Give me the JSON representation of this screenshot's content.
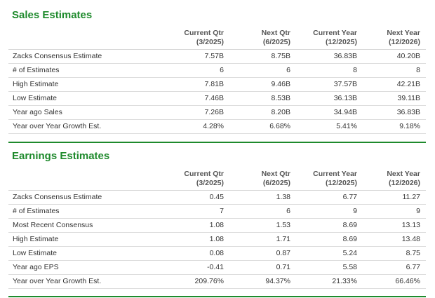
{
  "colors": {
    "accent": "#1e8a2c",
    "row_rule": "#dddddd"
  },
  "columns": [
    {
      "line1": "Current Qtr",
      "line2": "(3/2025)"
    },
    {
      "line1": "Next Qtr",
      "line2": "(6/2025)"
    },
    {
      "line1": "Current Year",
      "line2": "(12/2025)"
    },
    {
      "line1": "Next Year",
      "line2": "(12/2026)"
    }
  ],
  "sales": {
    "title": "Sales Estimates",
    "rows": [
      {
        "label": "Zacks Consensus Estimate",
        "values": [
          "7.57B",
          "8.75B",
          "36.83B",
          "40.20B"
        ]
      },
      {
        "label": "# of Estimates",
        "values": [
          "6",
          "6",
          "8",
          "8"
        ]
      },
      {
        "label": "High Estimate",
        "values": [
          "7.81B",
          "9.46B",
          "37.57B",
          "42.21B"
        ]
      },
      {
        "label": "Low Estimate",
        "values": [
          "7.46B",
          "8.53B",
          "36.13B",
          "39.11B"
        ]
      },
      {
        "label": "Year ago Sales",
        "values": [
          "7.26B",
          "8.20B",
          "34.94B",
          "36.83B"
        ]
      },
      {
        "label": "Year over Year Growth Est.",
        "values": [
          "4.28%",
          "6.68%",
          "5.41%",
          "9.18%"
        ]
      }
    ]
  },
  "earnings": {
    "title": "Earnings Estimates",
    "rows": [
      {
        "label": "Zacks Consensus Estimate",
        "values": [
          "0.45",
          "1.38",
          "6.77",
          "11.27"
        ]
      },
      {
        "label": "# of Estimates",
        "values": [
          "7",
          "6",
          "9",
          "9"
        ]
      },
      {
        "label": "Most Recent Consensus",
        "values": [
          "1.08",
          "1.53",
          "8.69",
          "13.13"
        ]
      },
      {
        "label": "High Estimate",
        "values": [
          "1.08",
          "1.71",
          "8.69",
          "13.48"
        ]
      },
      {
        "label": "Low Estimate",
        "values": [
          "0.08",
          "0.87",
          "5.24",
          "8.75"
        ]
      },
      {
        "label": "Year ago EPS",
        "values": [
          "-0.41",
          "0.71",
          "5.58",
          "6.77"
        ]
      },
      {
        "label": "Year over Year Growth Est.",
        "values": [
          "209.76%",
          "94.37%",
          "21.33%",
          "66.46%"
        ]
      }
    ]
  }
}
